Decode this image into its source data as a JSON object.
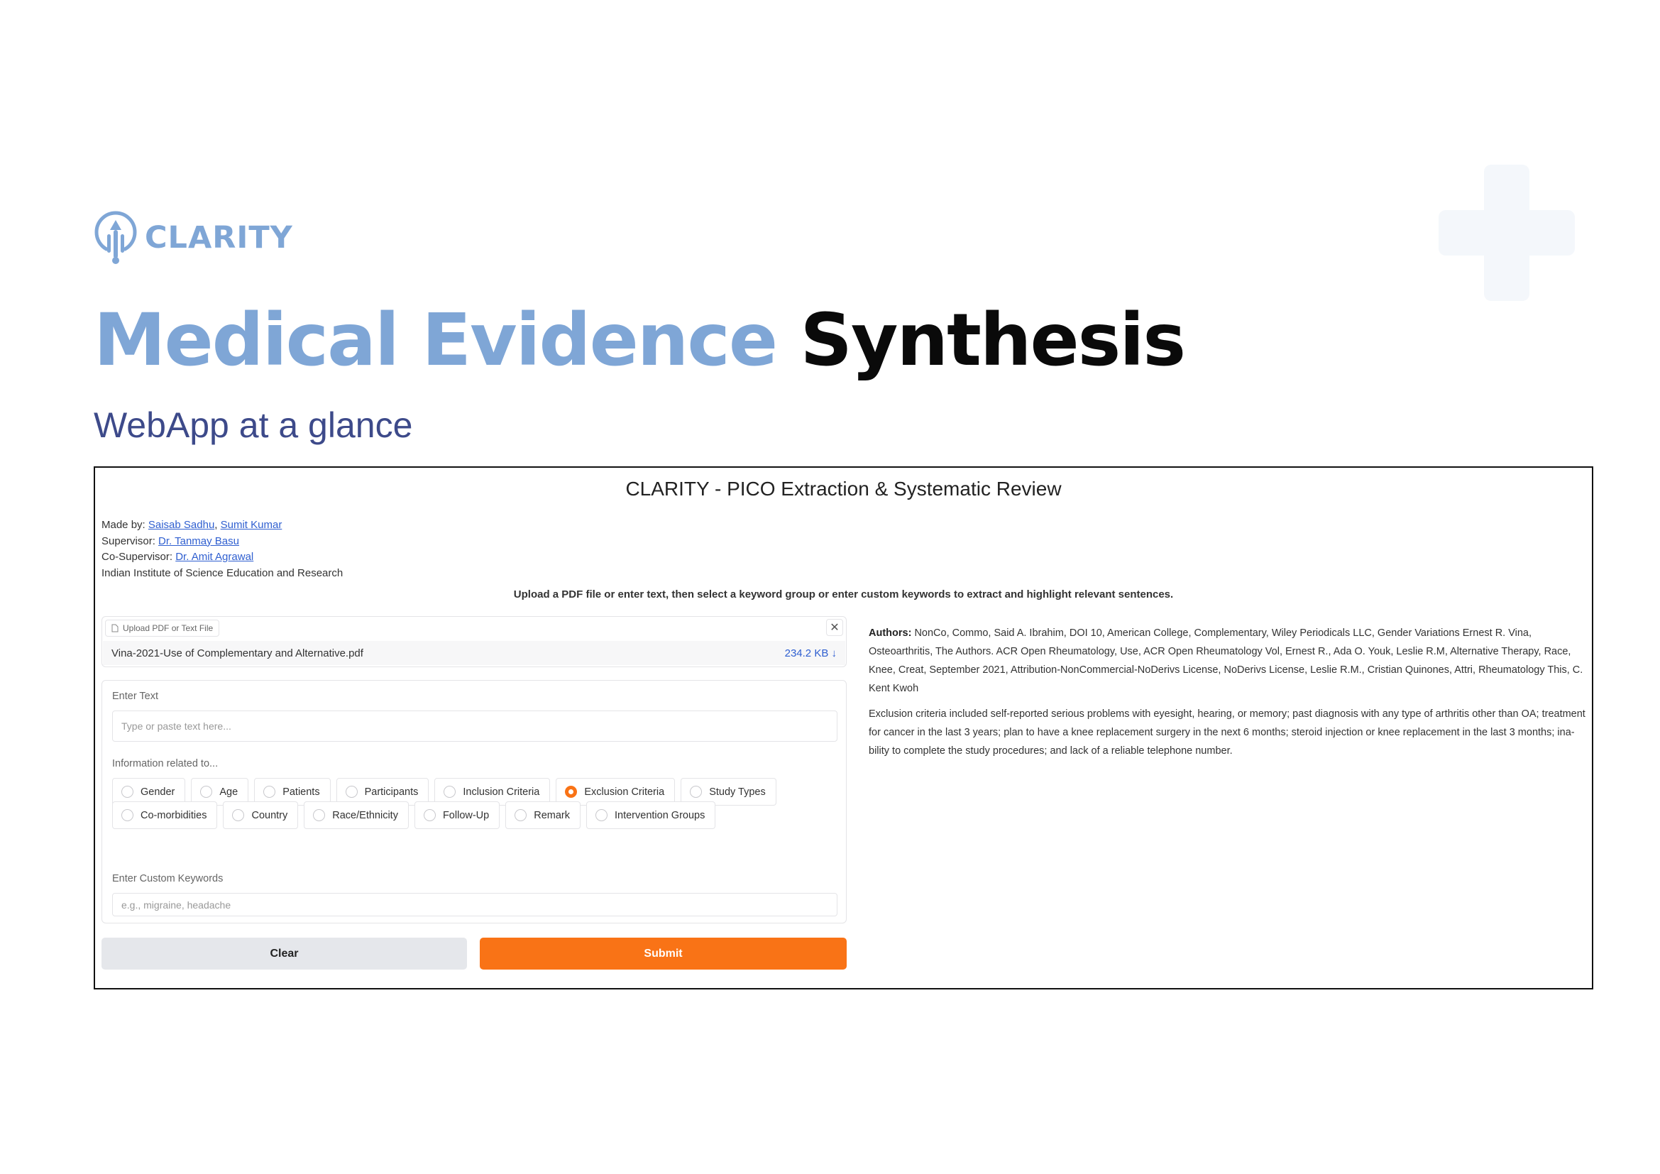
{
  "brand": {
    "logo_text": "CLARITY",
    "accent_color": "#7fa6d6"
  },
  "slide": {
    "title_part1": "Medical Evidence",
    "title_part2": "Synthesis",
    "subtitle": "WebApp at a glance"
  },
  "app": {
    "title": "CLARITY - PICO Extraction & Systematic Review",
    "credits": {
      "made_by_label": "Made by: ",
      "author1": "Saisab Sadhu",
      "separator": ", ",
      "author2": "Sumit Kumar",
      "supervisor_label": "Supervisor: ",
      "supervisor": "Dr. Tanmay Basu",
      "cosupervisor_label": "Co-Supervisor: ",
      "cosupervisor": "Dr. Amit Agrawal",
      "institute": "Indian Institute of Science Education and Research"
    },
    "instructions": "Upload a PDF file or enter text, then select a keyword group or enter custom keywords to extract and highlight relevant sentences.",
    "upload": {
      "label": "Upload PDF or Text File",
      "file_name": "Vina-2021-Use of Complementary and Alternative.pdf",
      "file_size": "234.2 KB ↓",
      "close": "✕"
    },
    "text_input": {
      "label": "Enter Text",
      "placeholder": "Type or paste text here..."
    },
    "info_group": {
      "label": "Information related to...",
      "selected": "Exclusion Criteria",
      "row1": [
        "Gender",
        "Age",
        "Patients",
        "Participants",
        "Inclusion Criteria",
        "Exclusion Criteria",
        "Study Types"
      ],
      "row2": [
        "Co-morbidities",
        "Country",
        "Race/Ethnicity",
        "Follow-Up",
        "Remark",
        "Intervention Groups"
      ]
    },
    "custom_keywords": {
      "label": "Enter Custom Keywords",
      "placeholder": "e.g., migraine, headache"
    },
    "buttons": {
      "clear": "Clear",
      "submit": "Submit"
    },
    "output": {
      "authors_label": "Authors:",
      "authors_text": " NonCo, Commo, Said A. Ibrahim, DOI 10, American College, Complementary, Wiley Periodicals LLC, Gender Variations Ernest R. Vina, Osteoarthritis, The Authors. ACR Open Rheumatology, Use, ACR Open Rheumatology Vol, Ernest R., Ada O. Youk, Leslie R.M, Alternative Therapy, Race, Knee, Creat, September 2021, Attribution-NonCommercial-NoDerivs License, NoDerivs License, Leslie R.M., Cristian Quinones, Attri, Rheumatology This, C. Kent Kwoh",
      "result": "Exclusion criteria included self-reported serious problems with eyesight, hearing, or memory; past diagnosis with any type of arthritis other than OA; treatment for cancer in the last 3 years; plan to have a knee replacement surgery in the next 6 months; steroid injection or knee replacement in the last 3 months; ina- bility to complete the study procedures; and lack of a reliable telephone number."
    }
  }
}
